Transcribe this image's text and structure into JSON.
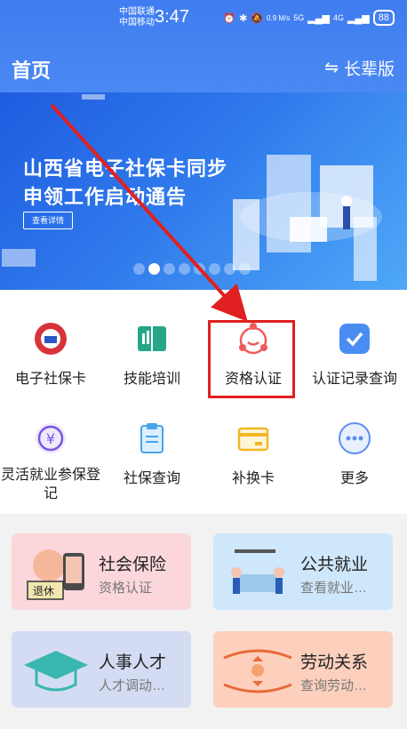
{
  "status": {
    "carrier1": "中国联通",
    "carrier2": "中国移动",
    "time": "3:47",
    "speed": "0.9 M/s",
    "sig1": "5G",
    "sig2": "4G",
    "battery": "88"
  },
  "header": {
    "title": "首页",
    "elder_label": "长辈版"
  },
  "banner": {
    "line1": "山西省电子社保卡同步",
    "line2": "申领工作启动通告",
    "detail": "查看详情",
    "slides": 8,
    "active": 1
  },
  "grid": {
    "items": [
      {
        "label": "电子社保卡"
      },
      {
        "label": "技能培训"
      },
      {
        "label": "资格认证"
      },
      {
        "label": "认证记录查询"
      },
      {
        "label": "灵活就业参保登记"
      },
      {
        "label": "社保查询"
      },
      {
        "label": "补换卡"
      },
      {
        "label": "更多"
      }
    ]
  },
  "cards": [
    {
      "title": "社会保险",
      "sub": "资格认证",
      "badge": "退休",
      "bg": "#fbd7dc"
    },
    {
      "title": "公共就业",
      "sub": "查看就业…",
      "bg": "#cfe7fb"
    },
    {
      "title": "人事人才",
      "sub": "人才调动…",
      "bg": "#d3dcf3"
    },
    {
      "title": "劳动关系",
      "sub": "查询劳动…",
      "bg": "#fcd0bd"
    }
  ],
  "colors": {
    "primary": "#3f7df0",
    "highlight": "#e02020"
  }
}
